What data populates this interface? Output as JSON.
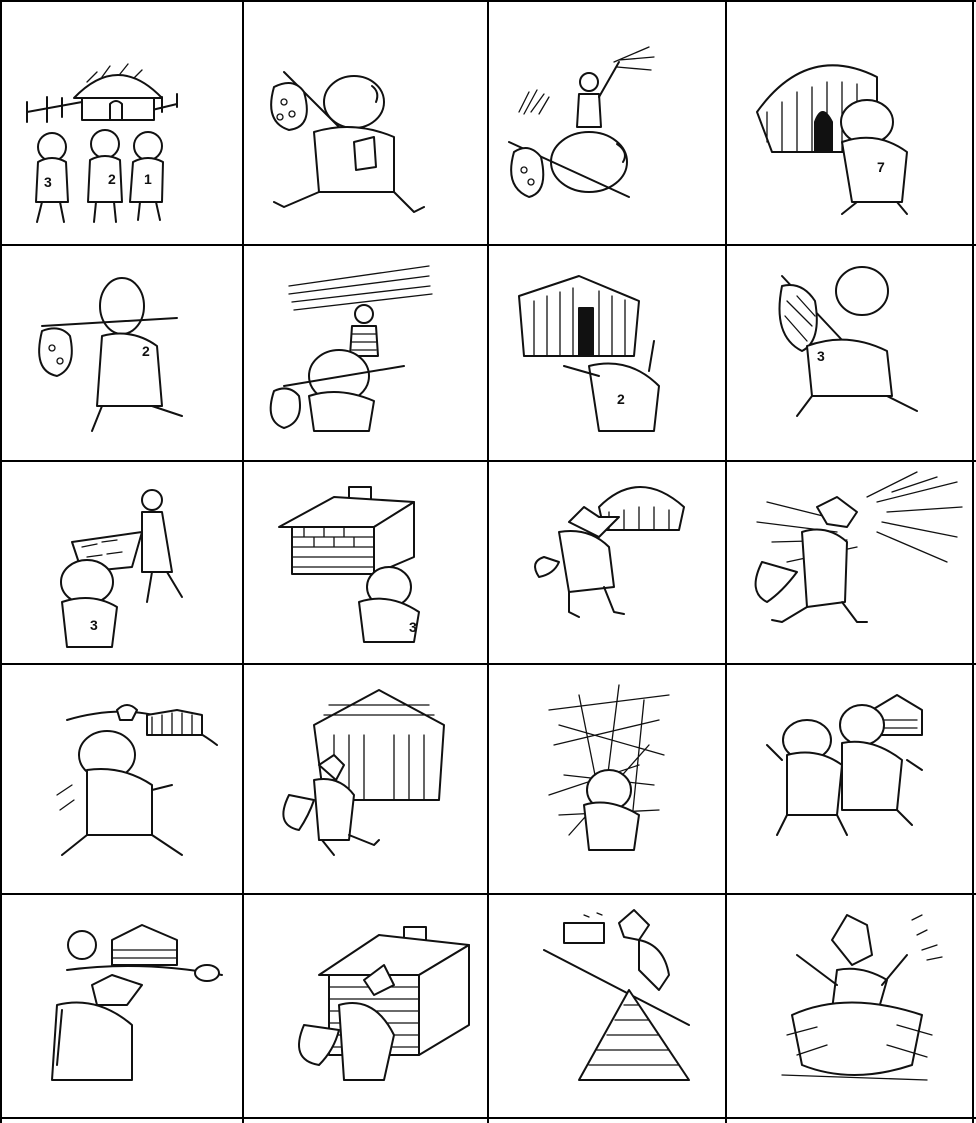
{
  "labels": {
    "pig_one": "1",
    "pig_two": "2",
    "pig_three": "3",
    "pig_seven": "7"
  }
}
